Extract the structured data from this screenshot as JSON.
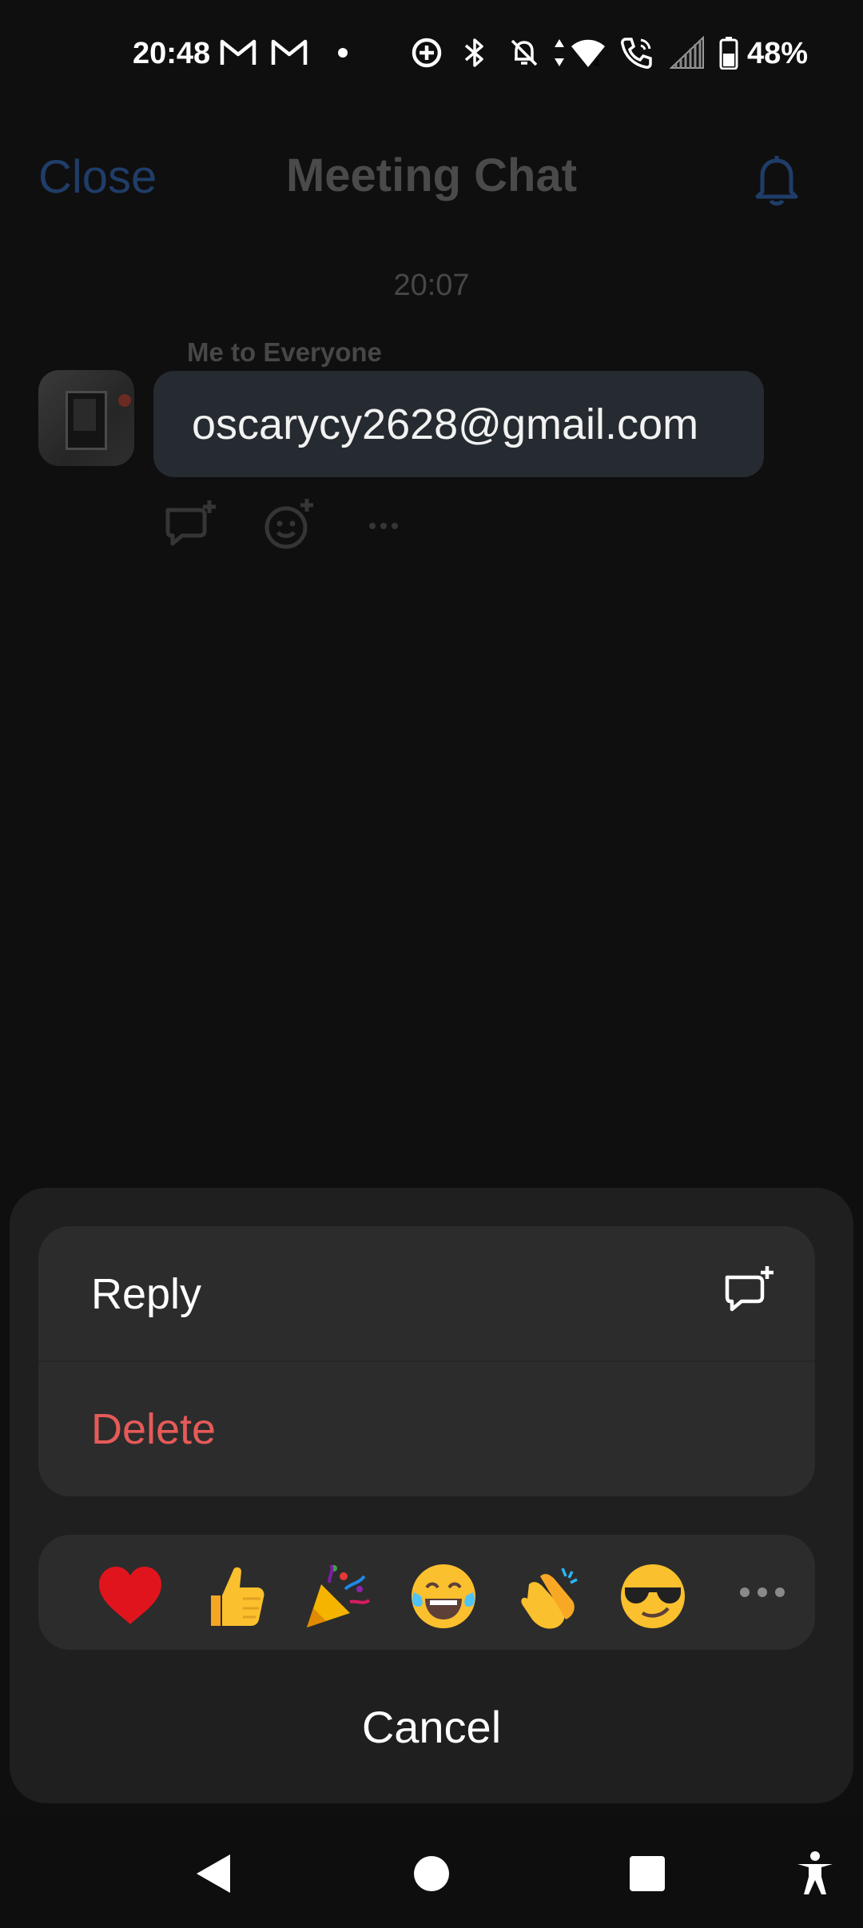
{
  "status_bar": {
    "time": "20:48",
    "battery_text": "48%",
    "icons": [
      "gmail-icon",
      "gmail-icon",
      "notification-dot-icon",
      "data-saver-icon",
      "bluetooth-icon",
      "silent-bell-icon",
      "data-arrows-icon",
      "wifi-icon",
      "wifi-call-icon",
      "signal-icon",
      "battery-icon"
    ]
  },
  "header": {
    "close_label": "Close",
    "title": "Meeting Chat",
    "bell_icon": "bell-icon",
    "accent_color": "#1f3d68"
  },
  "chat": {
    "timestamp": "20:07",
    "sender_label": "Me to Everyone",
    "message_text": "oscarycy2628@gmail.com",
    "message_actions": [
      "reply-icon",
      "add-reaction-icon",
      "more-icon"
    ]
  },
  "sheet": {
    "actions": [
      {
        "label": "Reply",
        "icon": "reply-icon",
        "color": "#ffffff"
      },
      {
        "label": "Delete",
        "color": "#e55b58"
      }
    ],
    "emojis": [
      "heart-emoji",
      "thumbs-up-emoji",
      "party-popper-emoji",
      "tears-of-joy-emoji",
      "clapping-hands-emoji",
      "sunglasses-emoji",
      "more-icon"
    ],
    "cancel_label": "Cancel"
  },
  "navbar": {
    "buttons": [
      "back-icon",
      "home-icon",
      "recents-icon",
      "accessibility-icon"
    ]
  }
}
